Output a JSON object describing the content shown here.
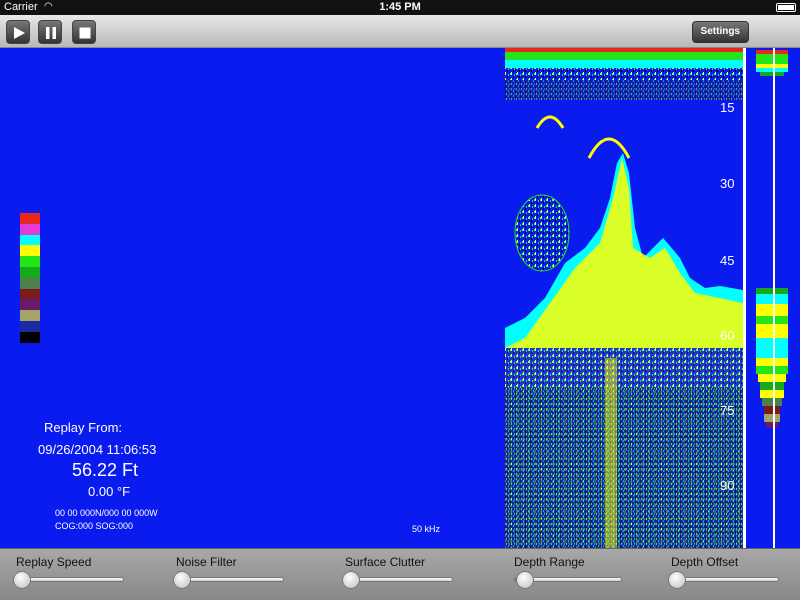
{
  "status_bar": {
    "carrier": "Carrier",
    "time": "1:45 PM",
    "battery": ""
  },
  "toolbar": {
    "settings_label": "Settings"
  },
  "color_scale": [
    "#e8281c",
    "#e23bd8",
    "#00ffff",
    "#ffff00",
    "#22e61a",
    "#16a91a",
    "#4c7f4c",
    "#7a1a1a",
    "#6a1a6a",
    "#a3a36a",
    "#1a2aa0",
    "#000000"
  ],
  "readout": {
    "replay_label": "Replay From:",
    "replay_datetime": "09/26/2004 11:06:53",
    "depth": "56.22 Ft",
    "temperature": "0.00 °F",
    "position": "00 00 000N/000 00 000W",
    "cog_sog": "COG:000 SOG:000",
    "frequency": "50 kHz"
  },
  "depth_scale": [
    "15",
    "30",
    "45",
    "60",
    "75",
    "90"
  ],
  "sliders": [
    {
      "label": "Replay Speed",
      "value": 0
    },
    {
      "label": "Noise Filter",
      "value": 0
    },
    {
      "label": "Surface Clutter",
      "value": 0
    },
    {
      "label": "Depth Range",
      "value": 0.05
    },
    {
      "label": "Depth Offset",
      "value": 0
    }
  ]
}
